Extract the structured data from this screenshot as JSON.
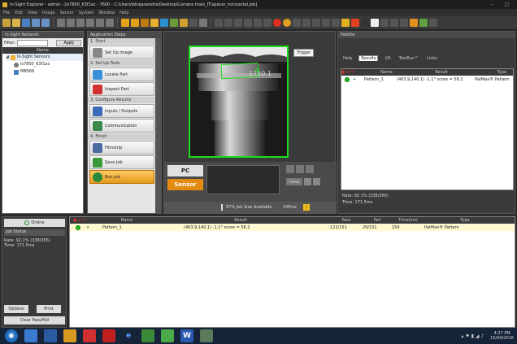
{
  "window": {
    "title": "In-Sight Explorer - admin - [is7800_63f1ac - 7600 - C:\\Users\\bhojanendra\\Desktop\\Camera trials_IT\\spacer_horizontal.job]"
  },
  "menu": [
    "File",
    "Edit",
    "View",
    "Image",
    "Sensor",
    "System",
    "Window",
    "Help"
  ],
  "network": {
    "header": "In-Sight Network",
    "filter_label": "Filter:",
    "filter_value": "",
    "apply_label": "Apply",
    "col_name": "Name",
    "tree": [
      {
        "label": "In-Sight Sensors"
      },
      {
        "label": "is7800_63f1ac"
      },
      {
        "label": "MB566"
      }
    ]
  },
  "steps": {
    "header": "Application Steps",
    "sections": [
      {
        "title": "1. Start",
        "items": [
          {
            "label": "Set Up Image"
          }
        ]
      },
      {
        "title": "2. Set Up Tools",
        "items": [
          {
            "label": "Locate Part"
          },
          {
            "label": "Inspect Part"
          }
        ]
      },
      {
        "title": "3. Configure Results",
        "items": [
          {
            "label": "Inputs / Outputs"
          },
          {
            "label": "Communication"
          }
        ]
      },
      {
        "title": "4. Finish",
        "items": [
          {
            "label": "Filmstrip"
          },
          {
            "label": "Save Job"
          },
          {
            "label": "Run Job"
          }
        ]
      }
    ]
  },
  "viewer": {
    "trigger_label": "Trigger",
    "overlay_text": "1750.1",
    "pc_label": "PC",
    "sensor_label": "Sensor",
    "freeze_label": "Freeze",
    "job_size_text": "97% Job Size Available",
    "offline_text": "Offline"
  },
  "palette": {
    "header": "Palette",
    "tabs": [
      "Help",
      "Results",
      "I/O",
      "TestRun™",
      "Links"
    ],
    "selected_tab": "Results",
    "columns": [
      "Name",
      "Result",
      "Type"
    ],
    "rows": [
      {
        "name": "Pattern_1",
        "result": "(463.9,140.1) -1.1° score = 58.2",
        "type": "PatMax® Pattern"
      }
    ],
    "rate_text": "Rate: 92.1% (338/365)",
    "time_text": "Time: 171.5ms"
  },
  "status": {
    "online_label": "Online",
    "job_status_label": "Job Status",
    "rate_text": "Rate: 92.1% (338/365)",
    "time_text": "Time: 171.5ms",
    "options_label": "Options",
    "print_label": "Print",
    "clear_label": "Clear Pass/Fail"
  },
  "bottom_table": {
    "columns": [
      "Name",
      "Result",
      "Pass",
      "Fail",
      "Time(ms)",
      "Type"
    ],
    "rows": [
      {
        "name": "Pattern_1",
        "result": "(463.9,140.1) -1.1° score = 58.2",
        "pass": "122/151",
        "fail": "29/151",
        "time": "154",
        "type": "PatMax® Pattern"
      }
    ]
  },
  "taskbar": {
    "time": "4:27 PM",
    "date": "15/04/2016"
  },
  "colors": {
    "accent": "#e59a1a",
    "pass": "#1fbf1f",
    "sensor": "#e38a10",
    "overlay": "#1cdc1c"
  }
}
